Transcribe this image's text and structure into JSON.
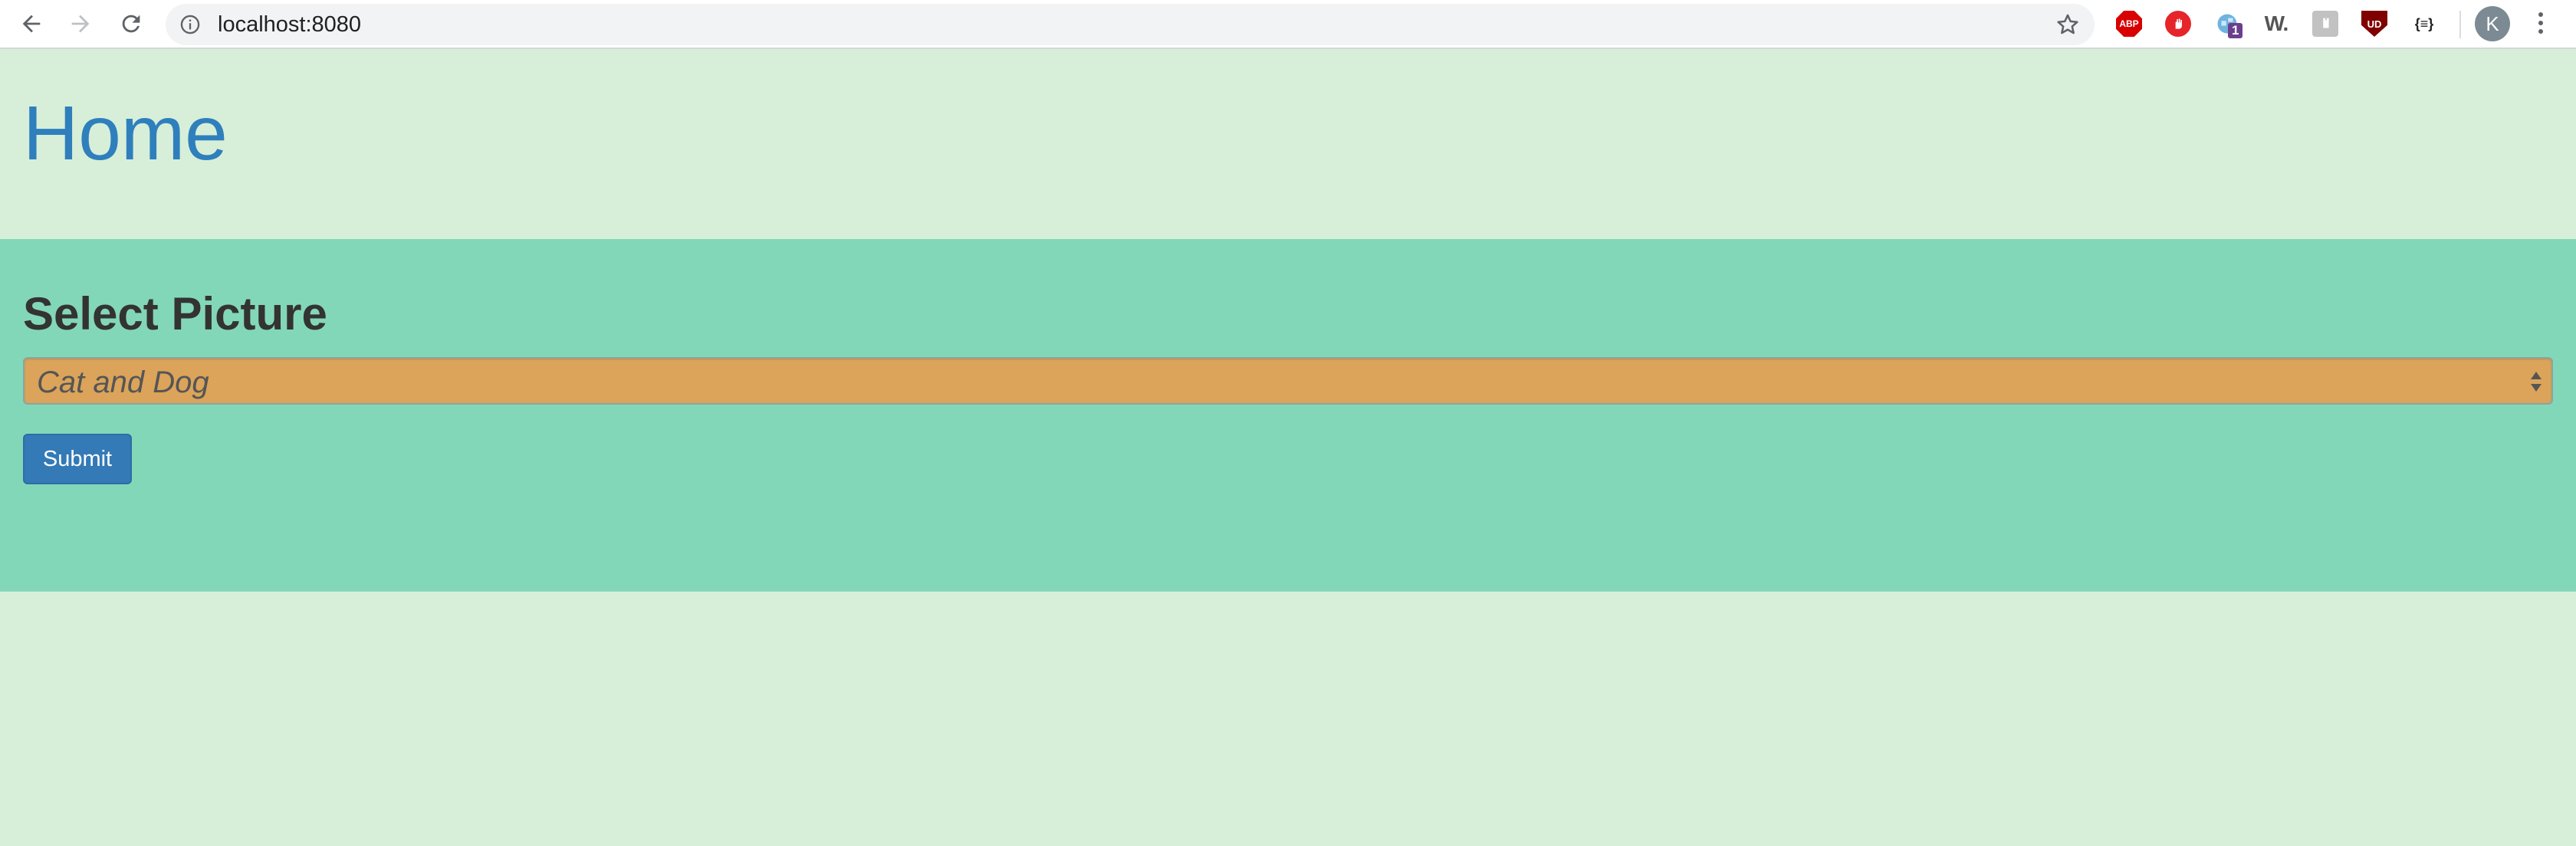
{
  "browser": {
    "url": "localhost:8080",
    "extensions": [
      {
        "name": "adblock-plus-icon",
        "label": "ABP"
      },
      {
        "name": "stop-hand-icon",
        "label": ""
      },
      {
        "name": "globe-extension-icon",
        "badge": "1"
      },
      {
        "name": "w-extension-icon",
        "label": "W."
      },
      {
        "name": "gray-extension-icon",
        "label": ""
      },
      {
        "name": "ublock-icon",
        "label": "UD"
      },
      {
        "name": "json-viewer-icon",
        "label": "{≡}"
      }
    ],
    "avatar_initial": "K"
  },
  "page": {
    "title": "Home",
    "form": {
      "label": "Select Picture",
      "select_value": "Cat and Dog",
      "submit_label": "Submit"
    }
  },
  "colors": {
    "page_background": "#d7efd8",
    "panel_background": "#83d7b9",
    "title_color": "#2f7fbd",
    "select_background": "#dba45a",
    "button_primary": "#337ab7"
  }
}
